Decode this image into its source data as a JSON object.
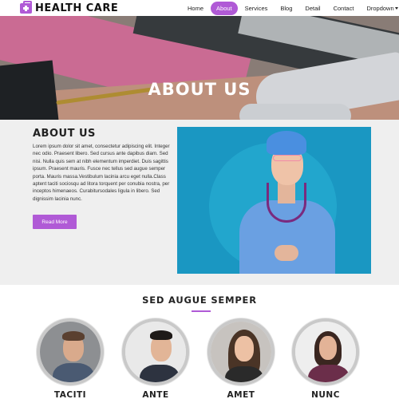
{
  "brand": {
    "name": "HEALTH CARE",
    "icon": "medical-kit-icon",
    "color": "#b05ad6"
  },
  "nav": {
    "items": [
      {
        "label": "Home",
        "active": false
      },
      {
        "label": "About",
        "active": true
      },
      {
        "label": "Services",
        "active": false
      },
      {
        "label": "Blog",
        "active": false
      },
      {
        "label": "Detail",
        "active": false
      },
      {
        "label": "Contact",
        "active": false
      },
      {
        "label": "Dropdown",
        "active": false,
        "has_caret": true
      }
    ]
  },
  "hero": {
    "title": "ABOUT US"
  },
  "about": {
    "title": "ABOUT US",
    "text": "Lorem ipsum dolor sit amet, consectetur adipiscing elit. Integer nec odio. Praesent libero. Sed cursus ante dapibus diam. Sed nisi. Nulla quis sem at nibh elementum imperdiet. Duis sagittis ipsum. Praesent mauris. Fusce nec tellus sed augue semper porta. Mauris massa.Vestibulum lacinia arcu eget nulla.Class aptent taciti sociosqu ad litora torquent per conubia nostra, per inceptos himenaeos. Curabitursodales ligula in libero. Sed dignissim lacinia nunc.",
    "button_label": "Read More"
  },
  "team": {
    "title": "SED AUGUE SEMPER",
    "members": [
      {
        "name": "TACITI"
      },
      {
        "name": "ANTE"
      },
      {
        "name": "AMET"
      },
      {
        "name": "NUNC"
      }
    ]
  },
  "colors": {
    "accent": "#b05ad6",
    "about_bg": "#efefef"
  }
}
